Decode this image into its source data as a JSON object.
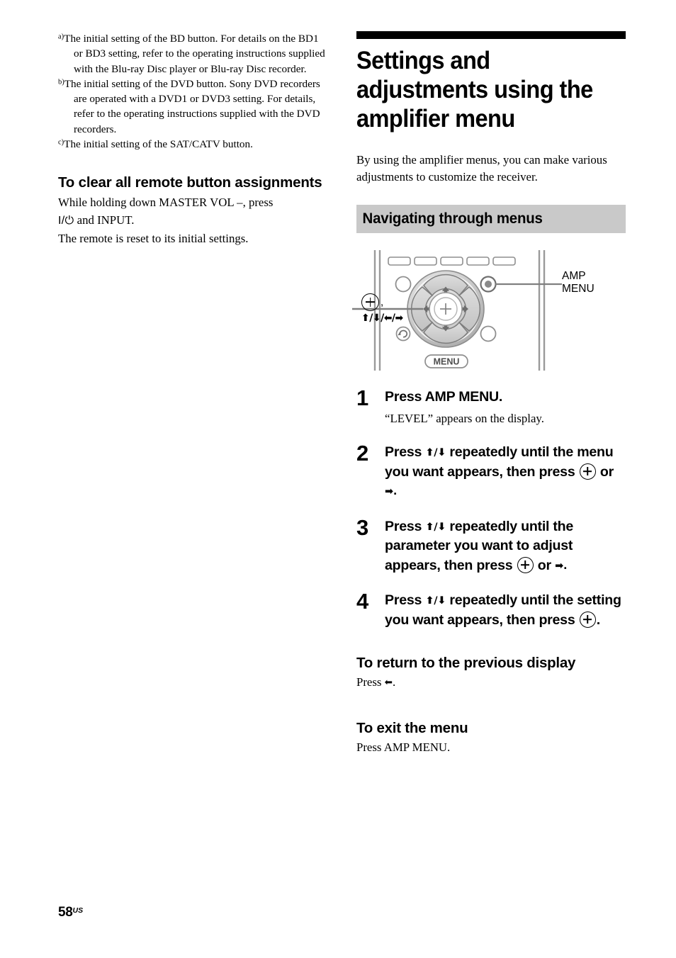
{
  "page": {
    "number": "58",
    "region_suffix": "US"
  },
  "left_column": {
    "footnotes": [
      {
        "marker": "a)",
        "text": "The initial setting of the BD button. For details on the BD1 or BD3 setting, refer to the operating instructions supplied with the Blu-ray Disc player or Blu-ray Disc recorder."
      },
      {
        "marker": "b)",
        "text": "The initial setting of the DVD button. Sony DVD recorders are operated with a DVD1 or DVD3 setting. For details, refer to the operating instructions supplied with the DVD recorders."
      },
      {
        "marker": "c)",
        "text": "The initial setting of the SAT/CATV button."
      }
    ],
    "clear_section": {
      "heading": "To clear all remote button assignments",
      "line1_before": "While holding down MASTER VOL –, press",
      "power_glyph": "I/⏻",
      "line2_after": " and INPUT.",
      "line3": "The remote is reset to its initial settings."
    }
  },
  "right_column": {
    "chapter_title": "Settings and adjustments using the amplifier menu",
    "intro": "By using the amplifier menus, you can make various adjustments to customize the receiver.",
    "section_bar": "Navigating through menus",
    "figure": {
      "callout_left_symbol": "⊕ ,",
      "callout_left_arrows": "⬆/⬇/⬅/➡",
      "callout_right_line1": "AMP",
      "callout_right_line2": "MENU",
      "menu_button_label": "MENU"
    },
    "steps": [
      {
        "number": "1",
        "heading": "Press AMP MENU.",
        "note": "“LEVEL” appears on the display."
      },
      {
        "number": "2",
        "heading_parts": {
          "a": "Press ",
          "arrows": "⬆/⬇",
          "b": " repeatedly until the menu you want appears, then press ",
          "c": " or ",
          "d": "➡."
        },
        "note": ""
      },
      {
        "number": "3",
        "heading_parts": {
          "a": "Press ",
          "arrows": "⬆/⬇",
          "b": " repeatedly until the parameter you want to adjust appears, then press ",
          "c": " or ",
          "d": "➡."
        },
        "note": ""
      },
      {
        "number": "4",
        "heading_parts": {
          "a": "Press ",
          "arrows": "⬆/⬇",
          "b": " repeatedly until the setting you want appears, then press ",
          "c": "",
          "d": "."
        },
        "note": ""
      }
    ],
    "return_section": {
      "heading": "To return to the previous display",
      "text_before": "Press ",
      "arrow": "⬅",
      "text_after": "."
    },
    "exit_section": {
      "heading": "To exit the menu",
      "text": "Press AMP MENU."
    }
  },
  "colors": {
    "rule_black": "#000000",
    "section_bar_gray": "#c9c9c9",
    "button_gray": "#d2d2d2",
    "outline_gray": "#808080"
  }
}
